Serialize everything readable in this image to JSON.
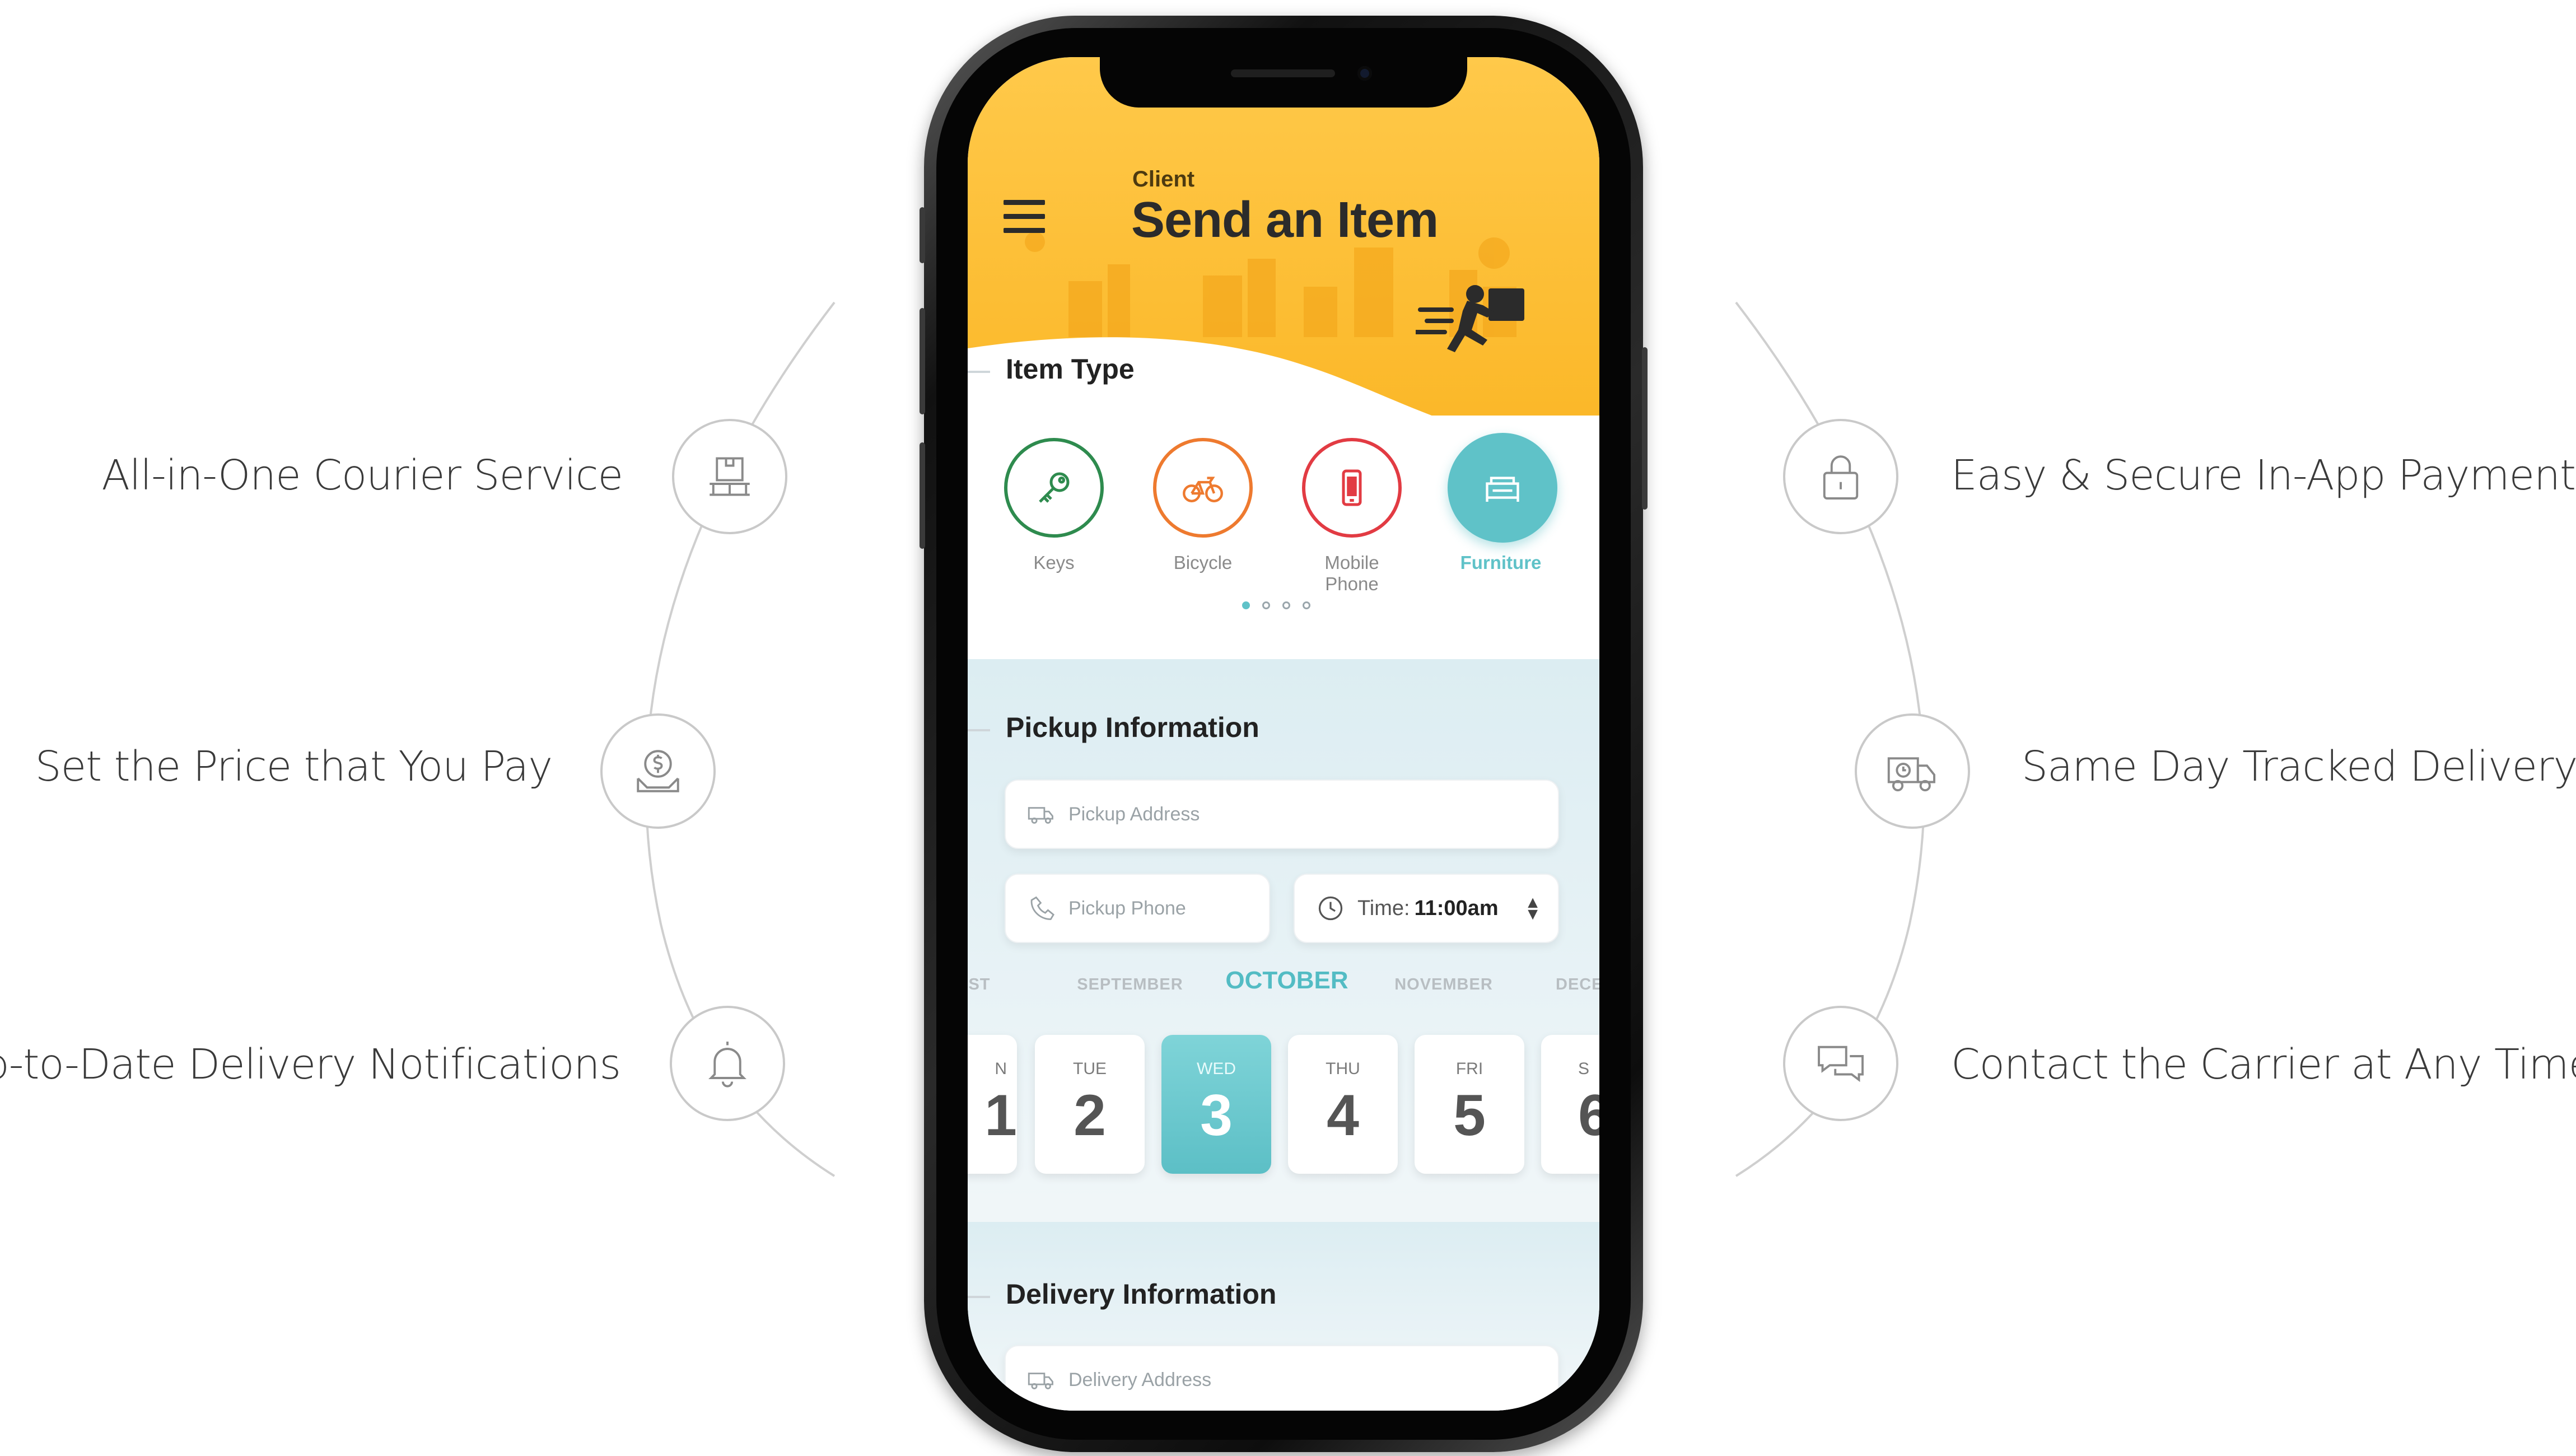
{
  "features": {
    "left": [
      {
        "label": "All-in-One Courier Service",
        "icon": "box-on-pallet-icon"
      },
      {
        "label": "Set the Price that You Pay",
        "icon": "dollar-hand-icon"
      },
      {
        "label": "Up-to-Date Delivery Notifications",
        "icon": "bell-icon"
      }
    ],
    "right": [
      {
        "label": "Easy & Secure In-App Payment",
        "icon": "lock-icon"
      },
      {
        "label": "Same Day Tracked Delivery",
        "icon": "delivery-truck-icon"
      },
      {
        "label": "Contact the Carrier at Any Time",
        "icon": "chat-bubbles-icon"
      }
    ]
  },
  "app": {
    "header": {
      "role": "Client",
      "title": "Send an Item",
      "menu_icon": "hamburger-menu-icon"
    },
    "item_type": {
      "title": "Item Type",
      "items": [
        {
          "label": "Keys",
          "icon": "key-icon",
          "color": "#2e8b4e"
        },
        {
          "label": "Bicycle",
          "icon": "bicycle-icon",
          "color": "#ee7a2f"
        },
        {
          "label": "Mobile Phone",
          "icon": "mobile-phone-icon",
          "color": "#e23b43"
        },
        {
          "label": "Furniture",
          "icon": "sofa-icon",
          "color": "#5fc2c8",
          "selected": true
        }
      ],
      "page_count": 4,
      "active_page": 1
    },
    "pickup": {
      "title": "Pickup Information",
      "address_placeholder": "Pickup Address",
      "phone_placeholder": "Pickup Phone",
      "time_label": "Time:",
      "time_value": "11:00am"
    },
    "calendar": {
      "months": [
        "UST",
        "SEPTEMBER",
        "OCTOBER",
        "NOVEMBER",
        "DECE"
      ],
      "selected_month": "OCTOBER",
      "days": [
        {
          "name": "N",
          "num": "1"
        },
        {
          "name": "TUE",
          "num": "2"
        },
        {
          "name": "WED",
          "num": "3",
          "selected": true
        },
        {
          "name": "THU",
          "num": "4"
        },
        {
          "name": "FRI",
          "num": "5"
        },
        {
          "name": "S",
          "num": "6"
        }
      ]
    },
    "delivery": {
      "title": "Delivery Information",
      "address_placeholder": "Delivery Address"
    },
    "accent_color": "#fbb829",
    "teal_color": "#5fc2c8"
  }
}
